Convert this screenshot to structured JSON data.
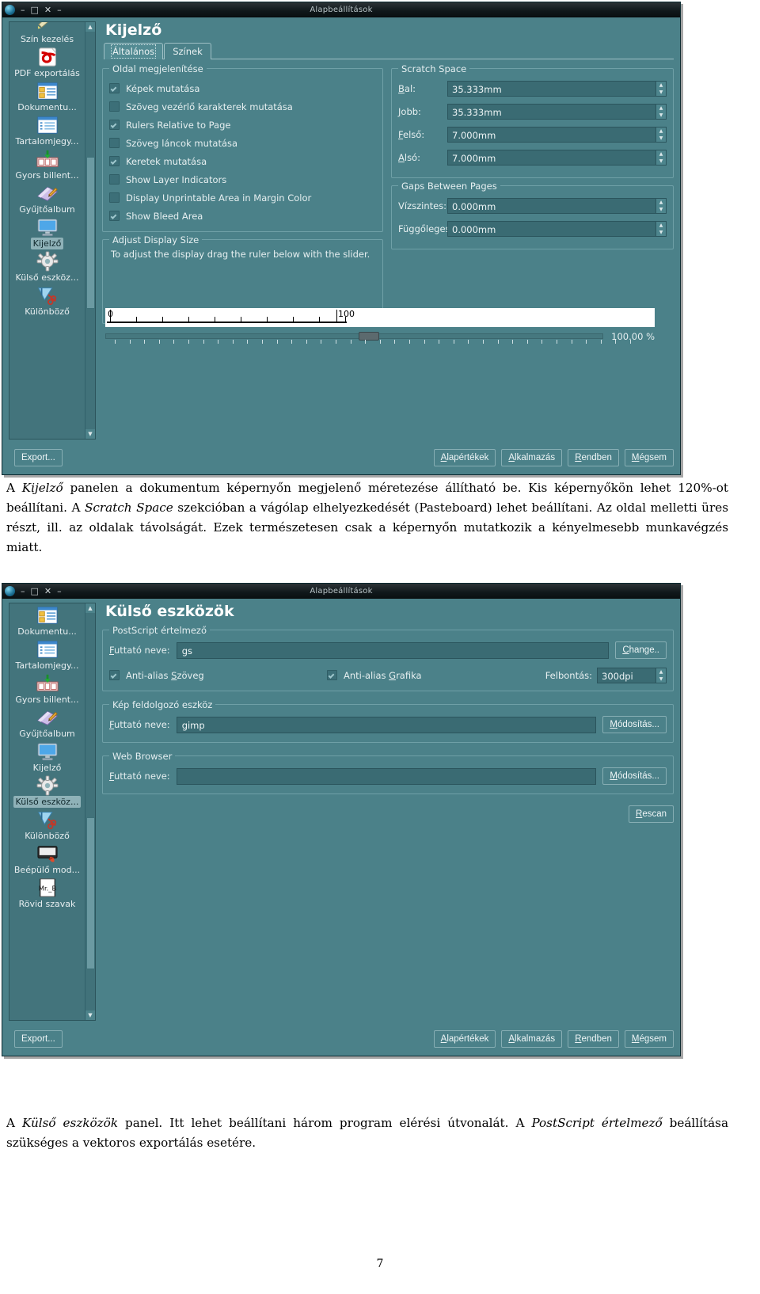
{
  "window1": {
    "title": "Alapbeállítások",
    "titlebar_buttons": [
      "minimize",
      "maximize",
      "close",
      "shade"
    ],
    "sidebar": {
      "items": [
        {
          "label": "Szín kezelés",
          "icon": "color-management-icon",
          "selected": false
        },
        {
          "label": "PDF exportálás",
          "icon": "pdf-export-icon",
          "selected": false
        },
        {
          "label": "Dokumentu...",
          "icon": "document-icon",
          "selected": false
        },
        {
          "label": "Tartalomjegy...",
          "icon": "table-of-contents-icon",
          "selected": false
        },
        {
          "label": "Gyors billent...",
          "icon": "keyboard-shortcuts-icon",
          "selected": false
        },
        {
          "label": "Gyűjtőalbum",
          "icon": "scrapbook-icon",
          "selected": false
        },
        {
          "label": "Kijelző",
          "icon": "display-monitor-icon",
          "selected": true
        },
        {
          "label": "Külső eszköz...",
          "icon": "gear-icon",
          "selected": false
        },
        {
          "label": "Különböző",
          "icon": "miscellaneous-icon",
          "selected": false
        }
      ]
    },
    "pane_title": "Kijelző",
    "tabs": [
      {
        "label": "Általános",
        "active": true
      },
      {
        "label": "Színek",
        "active": false
      }
    ],
    "groups": {
      "page_display": {
        "legend": "Oldal megjelenítése",
        "checkboxes": [
          {
            "label": "Képek mutatása",
            "checked": true
          },
          {
            "label": "Szöveg vezérlő karakterek mutatása",
            "checked": false
          },
          {
            "label": "Rulers Relative to Page",
            "checked": true
          },
          {
            "label": "Szöveg láncok mutatása",
            "checked": false
          },
          {
            "label": "Keretek mutatása",
            "checked": true
          },
          {
            "label": "Show Layer Indicators",
            "checked": false
          },
          {
            "label": "Display Unprintable Area in Margin Color",
            "checked": false
          },
          {
            "label": "Show Bleed Area",
            "checked": true
          }
        ]
      },
      "scratch_space": {
        "legend": "Scratch Space",
        "fields": [
          {
            "label": "Bal:",
            "value": "35.333mm",
            "mnemonic": "B"
          },
          {
            "label": "Jobb:",
            "value": "35.333mm",
            "mnemonic": "J"
          },
          {
            "label": "Felső:",
            "value": "7.000mm",
            "mnemonic": "F"
          },
          {
            "label": "Alsó:",
            "value": "7.000mm",
            "mnemonic": "A"
          }
        ]
      },
      "gaps_between_pages": {
        "legend": "Gaps Between Pages",
        "fields": [
          {
            "label": "Vízszintes:",
            "value": "0.000mm"
          },
          {
            "label": "Függőleges:",
            "value": "0.000mm"
          }
        ]
      },
      "adjust_display_size": {
        "legend": "Adjust Display Size",
        "hint": "To adjust the display drag the ruler below with the slider.",
        "ruler_start": "0",
        "ruler_end": "100",
        "zoom_value": "100.00 %"
      }
    },
    "footer": {
      "export": "Export...",
      "defaults": "Alapértékek",
      "apply": "Alkalmazás",
      "ok": "Rendben",
      "cancel": "Mégsem"
    }
  },
  "caption1": {
    "line1_a": "A ",
    "line1_it": "Kijelző",
    "line1_b": " panelen a dokumentum képernyőn megjelenő méretezése állítható be. Kis képernyőkön lehet 120%-ot beállítani. A ",
    "line2_it": "Scratch Space",
    "line2_b": " szekcióban a vágólap elhelyezkedését (Pasteboard) lehet beállítani. Az oldal melletti üres részt, ill. az oldalak távolságát. Ezek természetesen csak a képernyőn mutatkozik a kényelmesebb munkavégzés miatt."
  },
  "window2": {
    "title": "Alapbeállítások",
    "sidebar": {
      "items": [
        {
          "label": "Dokumentu...",
          "icon": "document-icon",
          "selected": false
        },
        {
          "label": "Tartalomjegy...",
          "icon": "table-of-contents-icon",
          "selected": false
        },
        {
          "label": "Gyors billent...",
          "icon": "keyboard-shortcuts-icon",
          "selected": false
        },
        {
          "label": "Gyűjtőalbum",
          "icon": "scrapbook-icon",
          "selected": false
        },
        {
          "label": "Kijelző",
          "icon": "display-monitor-icon",
          "selected": false
        },
        {
          "label": "Külső eszköz...",
          "icon": "gear-icon",
          "selected": true
        },
        {
          "label": "Különböző",
          "icon": "miscellaneous-icon",
          "selected": false
        },
        {
          "label": "Beépülő mod...",
          "icon": "plugins-icon",
          "selected": false
        },
        {
          "label": "Rövid szavak",
          "icon": "short-words-icon",
          "selected": false
        }
      ]
    },
    "pane_title": "Külső eszközök",
    "groups": {
      "postscript": {
        "legend": "PostScript értelmező",
        "runner_label": "Futtató neve:",
        "runner_value": "gs",
        "change_button": "Change..",
        "antialias_text": {
          "label": "Anti-alias Szöveg",
          "checked": true
        },
        "antialias_graphics": {
          "label": "Anti-alias Grafika",
          "checked": true
        },
        "resolution_label": "Felbontás:",
        "resolution_value": "300dpi"
      },
      "image_tool": {
        "legend": "Kép feldolgozó eszköz",
        "runner_label": "Futtató neve:",
        "runner_value": "gimp",
        "change_button": "Módosítás..."
      },
      "web_browser": {
        "legend": "Web Browser",
        "runner_label": "Futtató neve:",
        "runner_value": "",
        "change_button": "Módosítás..."
      },
      "rescan_button": "Rescan"
    },
    "footer": {
      "export": "Export...",
      "defaults": "Alapértékek",
      "apply": "Alkalmazás",
      "ok": "Rendben",
      "cancel": "Mégsem"
    }
  },
  "caption2": {
    "a": "A ",
    "it1": "Külső eszközök",
    "b": " panel. Itt lehet beállítani három program elérési útvonalát. A ",
    "it2": "PostScript értelmező",
    "c": " beállítása szükséges a vektoros exportálás esetére."
  },
  "page_number": "7",
  "colors": {
    "window_bg": "#4b8189",
    "sidebar_bg": "#43747c",
    "input_bg": "#3a6b73",
    "titlebar": "#0f171a",
    "text": "#e6eff0"
  }
}
